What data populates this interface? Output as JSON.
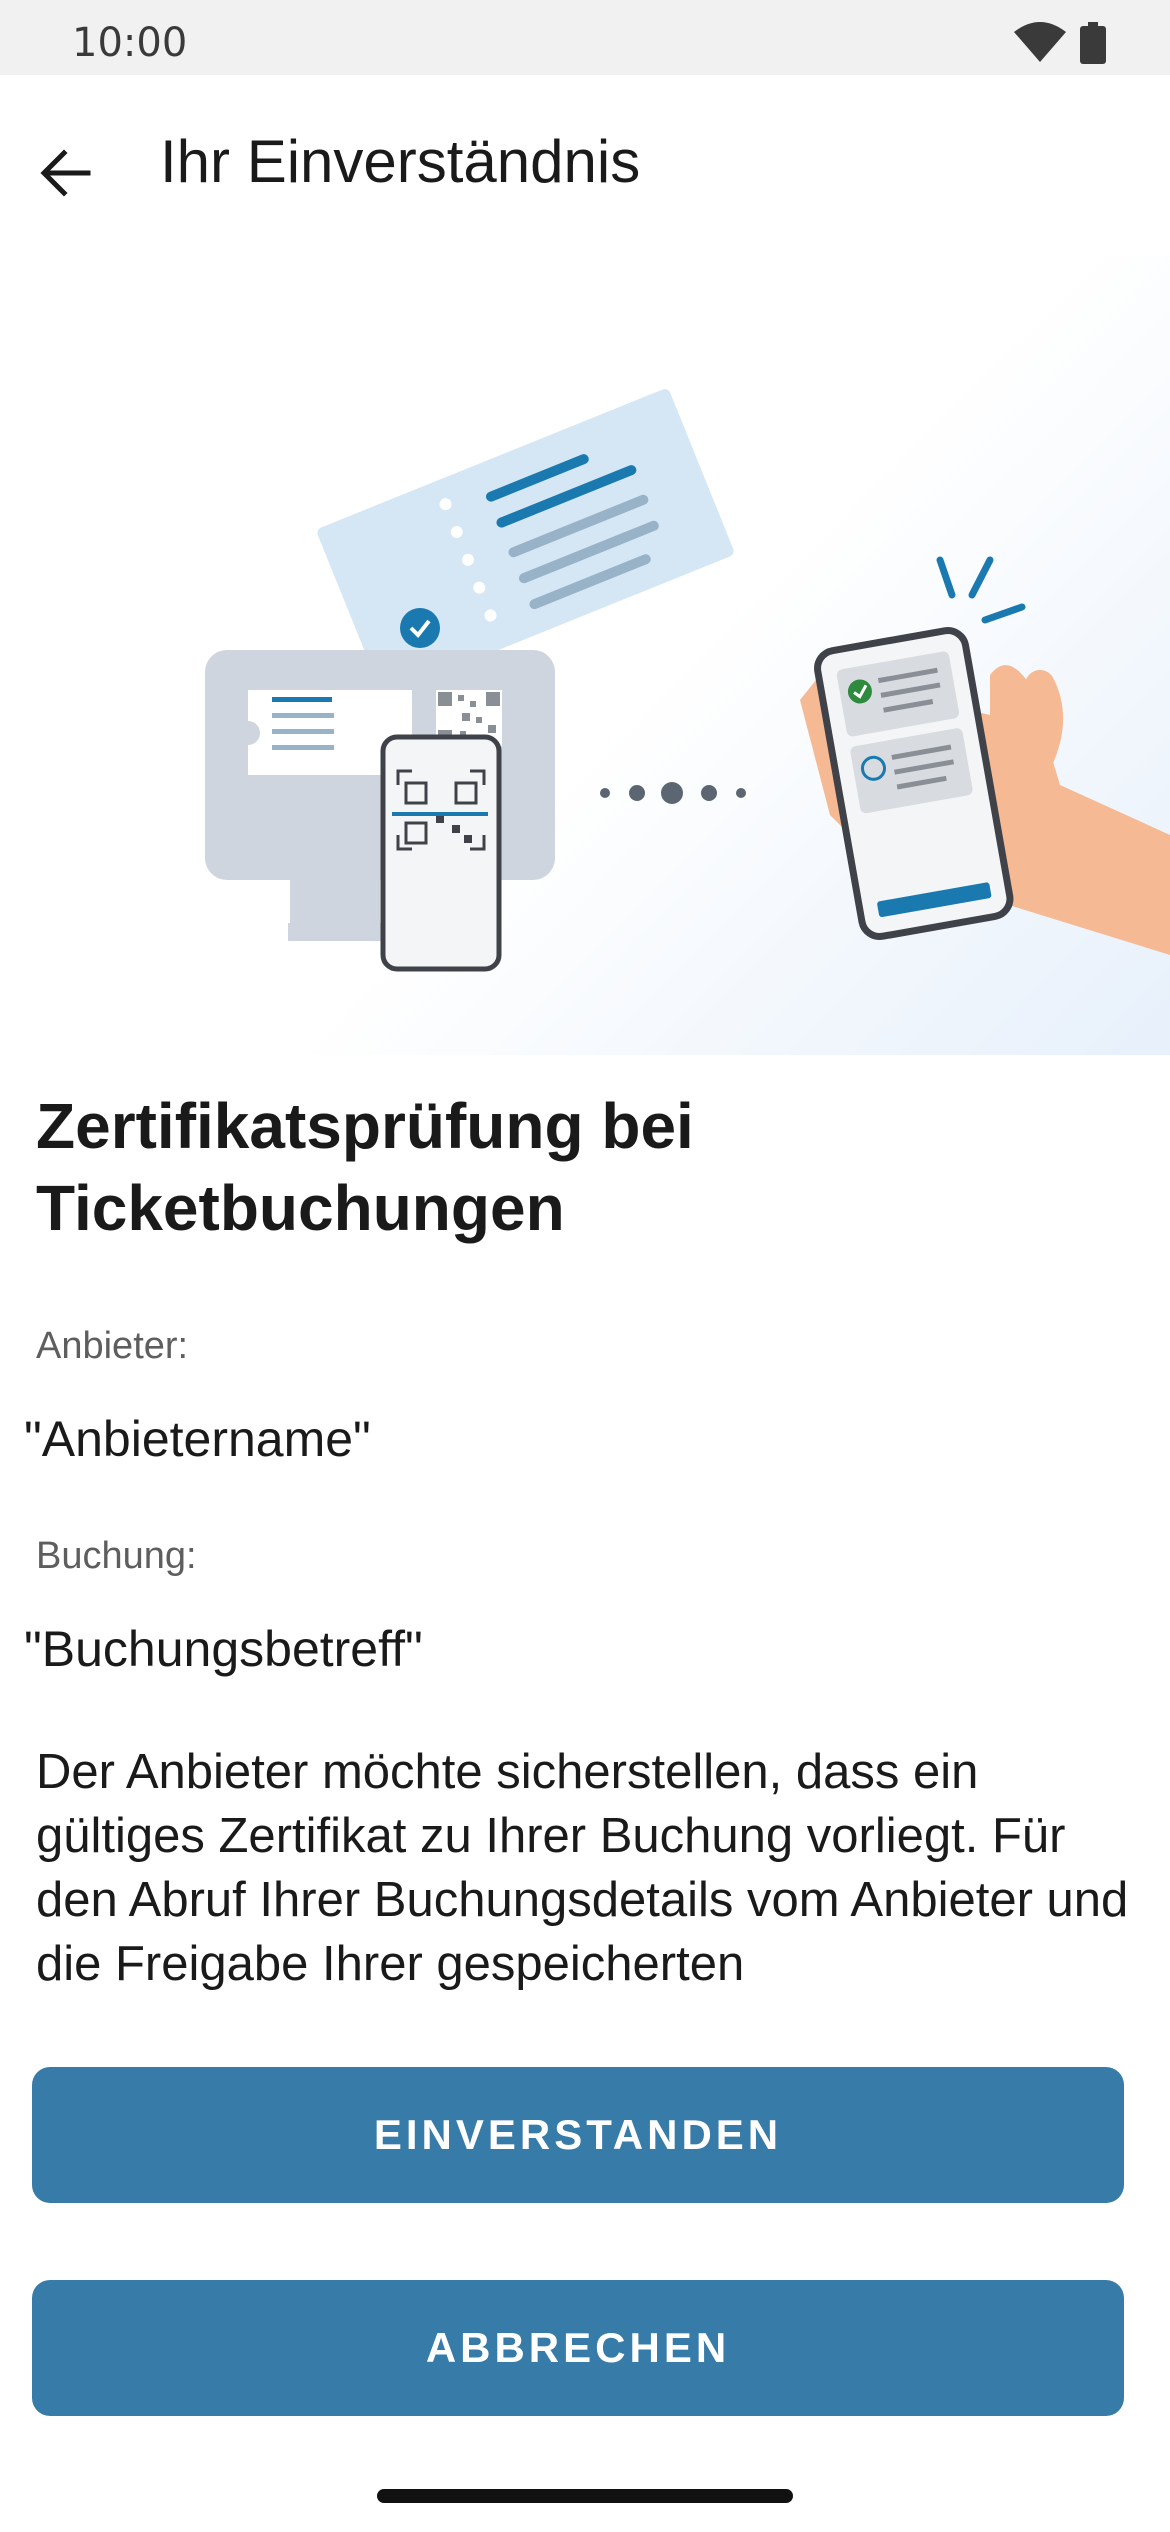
{
  "status_bar": {
    "time": "10:00",
    "icons": [
      "wifi-icon",
      "battery-icon"
    ]
  },
  "header": {
    "back_icon": "arrow-left-icon",
    "title": "Ihr Einverständnis"
  },
  "content": {
    "heading": "Zertifikatsprüfung bei Ticketbuchungen",
    "provider_label": "Anbieter:",
    "provider_value": "\"Anbietername\"",
    "booking_label": "Buchung:",
    "booking_value": "\"Buchungsbetreff\"",
    "description": "Der Anbieter möchte sicherstellen, dass ein gültiges Zertifikat zu Ihrer Buchung vorliegt. Für den Abruf Ihrer Buchungsdetails vom Anbieter und die Freigabe Ihrer gespeicherten"
  },
  "actions": {
    "accept_label": "EINVERSTANDEN",
    "cancel_label": "ABBRECHEN"
  },
  "colors": {
    "primary": "#377ba8",
    "accent_blue": "#1a7ab0",
    "check_green": "#2e8b3d",
    "skin": "#f5b993"
  }
}
